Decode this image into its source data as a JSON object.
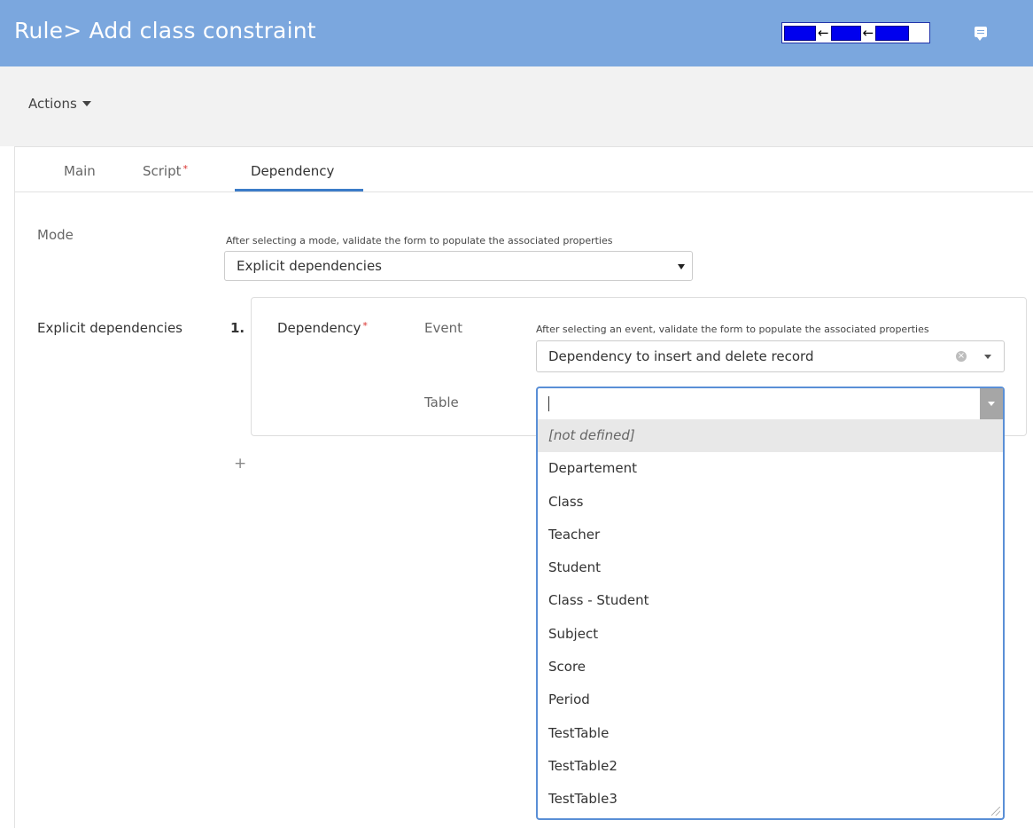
{
  "header": {
    "title": "Rule> Add class constraint",
    "breadcrumb_arrows": [
      "←",
      "←"
    ],
    "chat_icon": "chat-icon"
  },
  "actions": {
    "label": "Actions"
  },
  "tabs": [
    {
      "label": "Main",
      "required": false,
      "active": false
    },
    {
      "label": "Script",
      "required": true,
      "active": false
    },
    {
      "label": "Dependency",
      "required": false,
      "active": true
    }
  ],
  "required_mark": "*",
  "mode": {
    "label": "Mode",
    "hint": "After selecting a mode, validate the form to populate the associated properties",
    "value": "Explicit dependencies"
  },
  "explicit": {
    "label": "Explicit dependencies",
    "index": "1.",
    "dependency_label": "Dependency",
    "event_label": "Event",
    "event_hint": "After selecting an event, validate the form to populate the associated properties",
    "event_value": "Dependency to insert and delete record",
    "table_label": "Table",
    "table_value": "",
    "add_label": "+"
  },
  "table_options": [
    "[not defined]",
    "Departement",
    "Class",
    "Teacher",
    "Student",
    "Class - Student",
    "Subject",
    "Score",
    "Period",
    "TestTable",
    "TestTable2",
    "TestTable3"
  ],
  "colors": {
    "header_bg": "#7ba7de",
    "accent": "#3c7cc8",
    "required": "#d9302c",
    "focus_border": "#5a8fd6"
  }
}
